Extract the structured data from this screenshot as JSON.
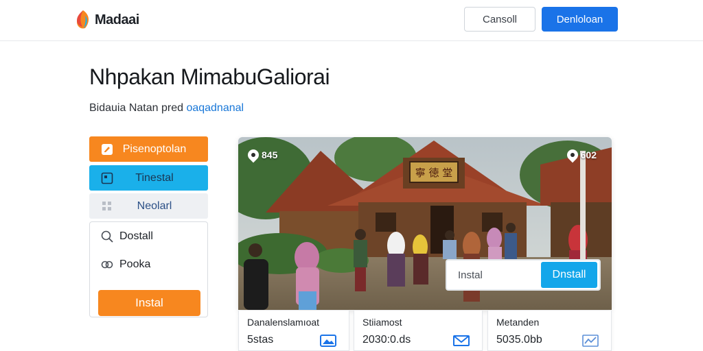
{
  "header": {
    "logo_text": "Madaai",
    "cancel_label": "Cansoll",
    "primary_label": "Denloloan"
  },
  "page": {
    "title": "Nhpakan MimabuGaliorai",
    "subtitle_text": "Bidauia  Natan  pred",
    "subtitle_link": "oaqadnanal"
  },
  "sidebar": {
    "buttons": [
      {
        "label": "Pisenoptolan",
        "icon": "edit-icon",
        "color": "#f7871f"
      },
      {
        "label": "Tinestal",
        "icon": "calendar-icon",
        "color": "#1ab0ea"
      },
      {
        "label": "Neolarl",
        "icon": "grid-icon",
        "color": "#eef0f3"
      }
    ],
    "items": [
      {
        "label": "Dostall",
        "icon": "search-icon"
      },
      {
        "label": "Pooka",
        "icon": "link-icon"
      }
    ],
    "install_label": "Instal"
  },
  "photo": {
    "left_chip": "845",
    "right_chip": "602",
    "signboard": "寧 徳 堂",
    "overlay_input": "Instal",
    "overlay_button": "Dnstall"
  },
  "stats": [
    {
      "label": "Danalenslamıoat",
      "value": "5stas",
      "icon": "image-icon"
    },
    {
      "label": "Stiiamost",
      "value": "2030:0.ds",
      "icon": "mail-icon"
    },
    {
      "label": "Metanden",
      "value": "5035.0bb",
      "icon": "chart-icon"
    }
  ],
  "colors": {
    "accent_blue": "#1a73e8",
    "orange": "#f7871f",
    "cyan": "#1ab0ea",
    "link": "#1877d8"
  }
}
